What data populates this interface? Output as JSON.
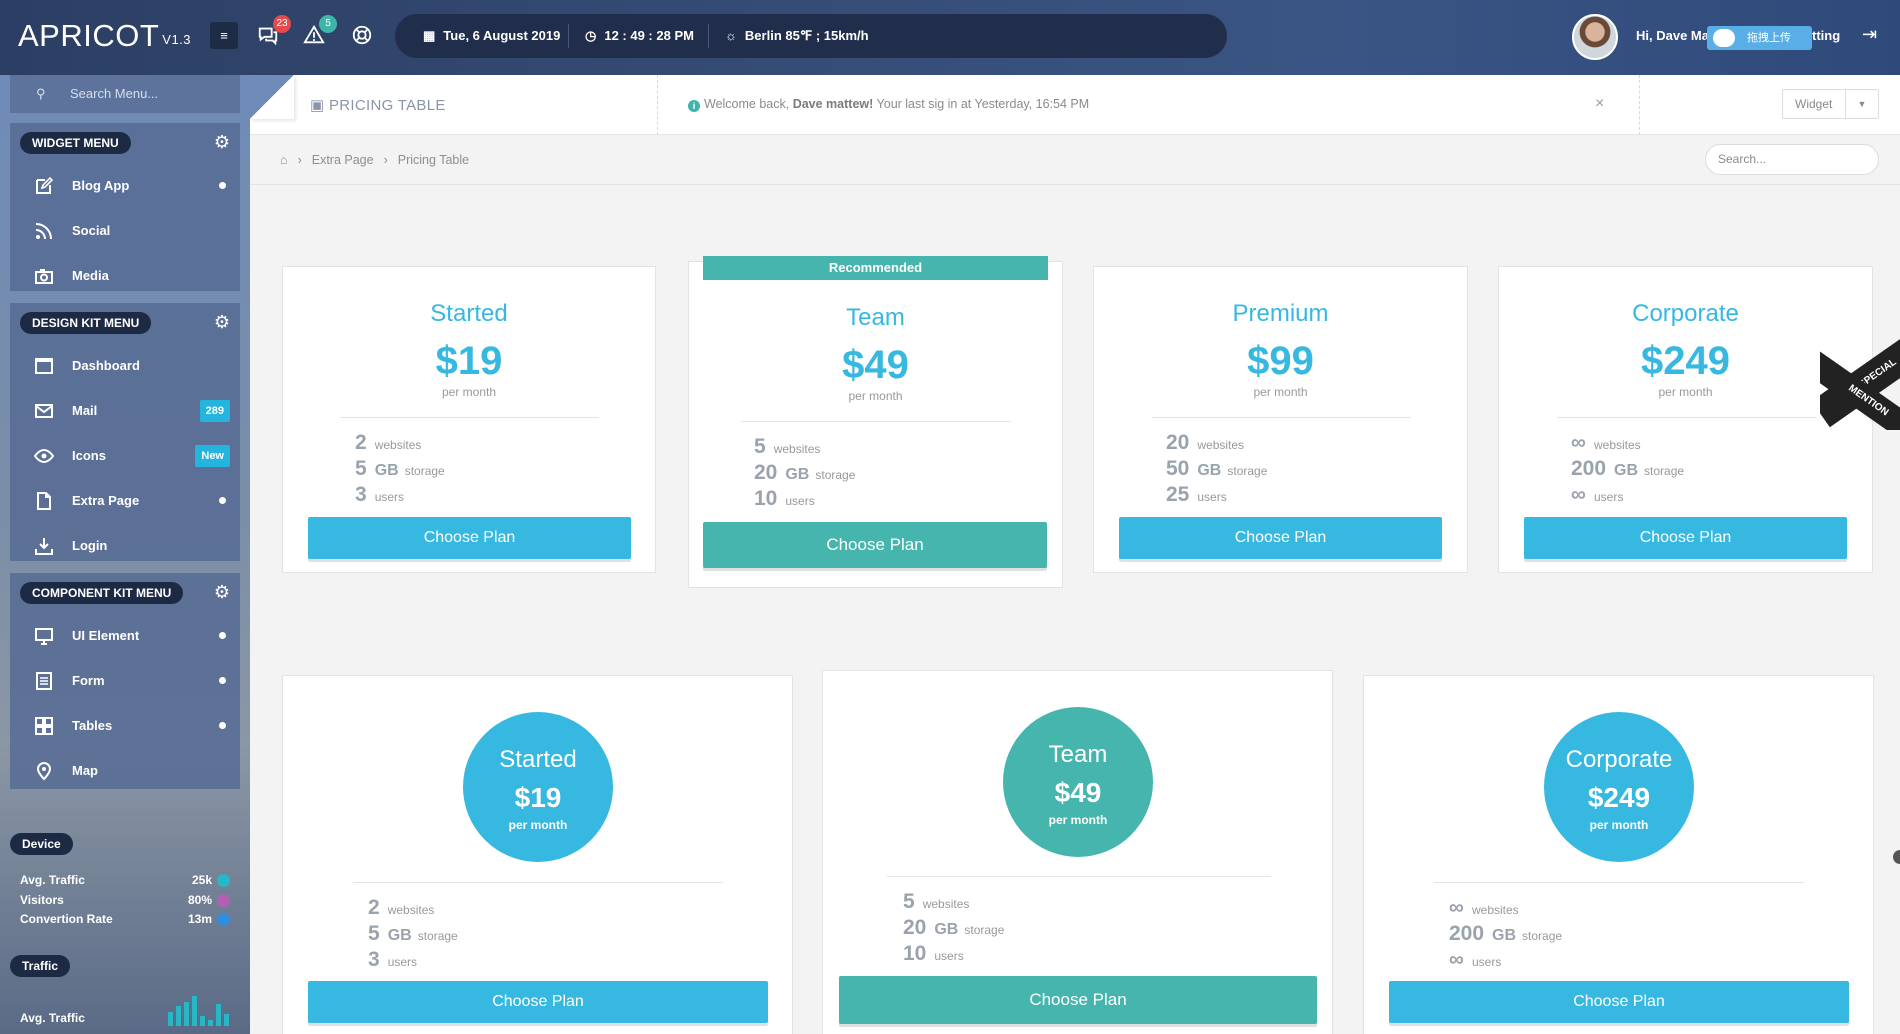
{
  "app": {
    "logo": "APRICOT",
    "version": "V1.3"
  },
  "topbar": {
    "messages_badge": "23",
    "alerts_badge": "5",
    "date": "Tue, 6 August 2019",
    "time": "12 : 49 : 28 PM",
    "weather": "Berlin  85℉ ; 15km/h",
    "greeting": "Hi, Dave Mat",
    "upload_chip": "拖拽上传",
    "setting_fragment": "tting",
    "colors": {
      "bar": "#2c3e63",
      "badge_red": "#e54b4b",
      "badge_teal": "#3fb4a8"
    }
  },
  "sidebar": {
    "search_placeholder": "Search Menu...",
    "widget_menu": {
      "title": "WIDGET MENU",
      "items": [
        {
          "label": "Blog App",
          "icon": "edit-icon",
          "marker": "dot"
        },
        {
          "label": "Social",
          "icon": "rss-icon",
          "marker": ""
        },
        {
          "label": "Media",
          "icon": "camera-icon",
          "marker": ""
        }
      ]
    },
    "design_menu": {
      "title": "DESIGN KIT MENU",
      "items": [
        {
          "label": "Dashboard",
          "icon": "window-icon",
          "marker": ""
        },
        {
          "label": "Mail",
          "icon": "mail-icon",
          "marker": "289"
        },
        {
          "label": "Icons",
          "icon": "eye-icon",
          "marker": "New"
        },
        {
          "label": "Extra Page",
          "icon": "file-icon",
          "marker": "dot"
        },
        {
          "label": "Login",
          "icon": "download-icon",
          "marker": ""
        }
      ]
    },
    "component_menu": {
      "title": "COMPONENT KIT MENU",
      "items": [
        {
          "label": "UI Element",
          "icon": "monitor-icon",
          "marker": "dot"
        },
        {
          "label": "Form",
          "icon": "form-icon",
          "marker": "dot"
        },
        {
          "label": "Tables",
          "icon": "grid-icon",
          "marker": "dot"
        },
        {
          "label": "Map",
          "icon": "map-pin-icon",
          "marker": ""
        }
      ]
    },
    "device": {
      "title": "Device",
      "rows": [
        {
          "label": "Avg. Traffic",
          "value": "25k",
          "color": "#27b8c8"
        },
        {
          "label": "Visitors",
          "value": "80%",
          "color": "#b45fb4"
        },
        {
          "label": "Convertion Rate",
          "value": "13m",
          "color": "#2f8ee0"
        }
      ]
    },
    "traffic": {
      "title": "Traffic",
      "label": "Avg. Traffic"
    }
  },
  "header": {
    "page_title": "PRICING TABLE",
    "welcome_prefix": "Welcome back,",
    "welcome_name": "Dave mattew!",
    "welcome_suffix": "Your last sig in at Yesterday, 16:54 PM",
    "close": "×",
    "widget_label": "Widget"
  },
  "breadcrumb": {
    "items": [
      "Extra Page",
      "Pricing Table"
    ],
    "search_placeholder": "Search..."
  },
  "pricing_top": [
    {
      "name": "Started",
      "price": "$19",
      "period": "per month",
      "websites": "2",
      "storage": "5",
      "users": "3",
      "button": "Choose Plan"
    },
    {
      "name": "Team",
      "price": "$49",
      "period": "per month",
      "websites": "5",
      "storage": "20",
      "users": "10",
      "button": "Choose Plan",
      "ribbon": "Recommended"
    },
    {
      "name": "Premium",
      "price": "$99",
      "period": "per month",
      "websites": "20",
      "storage": "50",
      "users": "25",
      "button": "Choose Plan"
    },
    {
      "name": "Corporate",
      "price": "$249",
      "period": "per month",
      "websites": "∞",
      "storage": "200",
      "users": "∞",
      "button": "Choose Plan",
      "corner_1": "SPECIAL",
      "corner_2": "MENTION"
    }
  ],
  "pricing_bottom": [
    {
      "name": "Started",
      "price": "$19",
      "period": "per month",
      "websites": "2",
      "storage": "5",
      "users": "3",
      "button": "Choose Plan"
    },
    {
      "name": "Team",
      "price": "$49",
      "period": "per month",
      "websites": "5",
      "storage": "20",
      "users": "10",
      "button": "Choose Plan"
    },
    {
      "name": "Corporate",
      "price": "$249",
      "period": "per month",
      "websites": "∞",
      "storage": "200",
      "users": "∞",
      "button": "Choose Plan"
    }
  ],
  "units": {
    "websites": "websites",
    "gb": "GB",
    "storage": "storage",
    "users": "users"
  }
}
